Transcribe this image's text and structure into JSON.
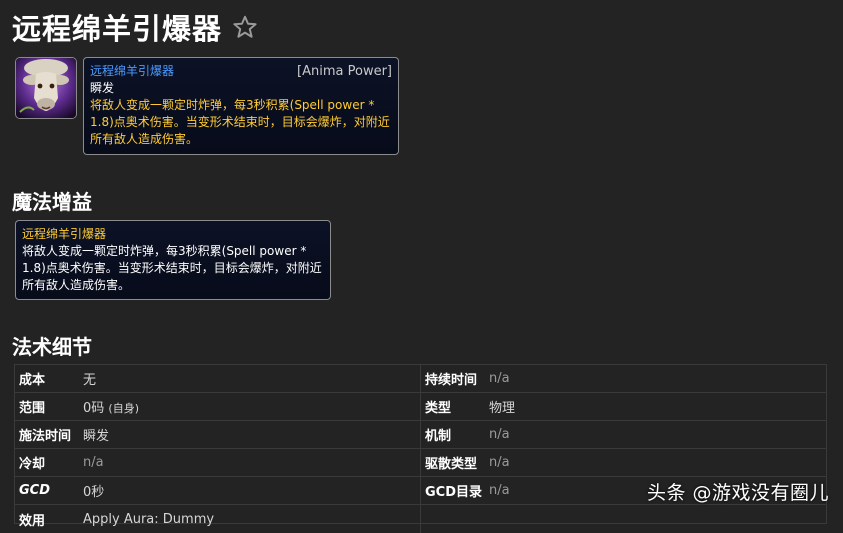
{
  "page": {
    "title": "远程绵羊引爆器"
  },
  "spell": {
    "tooltip": {
      "name": "远程绵羊引爆器",
      "tag": "[Anima Power]",
      "cast": "瞬发",
      "description": "将敌人变成一颗定时炸弹，每3秒积累(Spell power * 1.8)点奥术伤害。当变形术结束时，目标会爆炸，对附近所有敌人造成伤害。"
    }
  },
  "buff": {
    "section_title": "魔法增益",
    "name": "远程绵羊引爆器",
    "description": "将敌人变成一颗定时炸弹，每3秒积累(Spell power * 1.8)点奥术伤害。当变形术结束时，目标会爆炸，对附近所有敌人造成伤害。"
  },
  "details": {
    "section_title": "法术细节",
    "left": [
      {
        "label": "成本",
        "value": "无"
      },
      {
        "label": "范围",
        "value": "0码",
        "suffix": "(自身)"
      },
      {
        "label": "施法时间",
        "value": "瞬发"
      },
      {
        "label": "冷却",
        "value": "n/a"
      },
      {
        "label": "GCD",
        "value": "0秒"
      },
      {
        "label": "效用",
        "value": "Apply Aura: Dummy"
      }
    ],
    "right": [
      {
        "label": "持续时间",
        "value": "n/a"
      },
      {
        "label": "类型",
        "value": "物理"
      },
      {
        "label": "机制",
        "value": "n/a"
      },
      {
        "label": "驱散类型",
        "value": "n/a"
      },
      {
        "label": "GCD目录",
        "value": "n/a"
      }
    ]
  },
  "watermark": "头条 @游戏没有圈儿",
  "colors": {
    "background": "#232323",
    "tooltip_bg": "#0c1226",
    "spell_name_blue": "#4c9cff",
    "gold": "#ffcc33"
  }
}
